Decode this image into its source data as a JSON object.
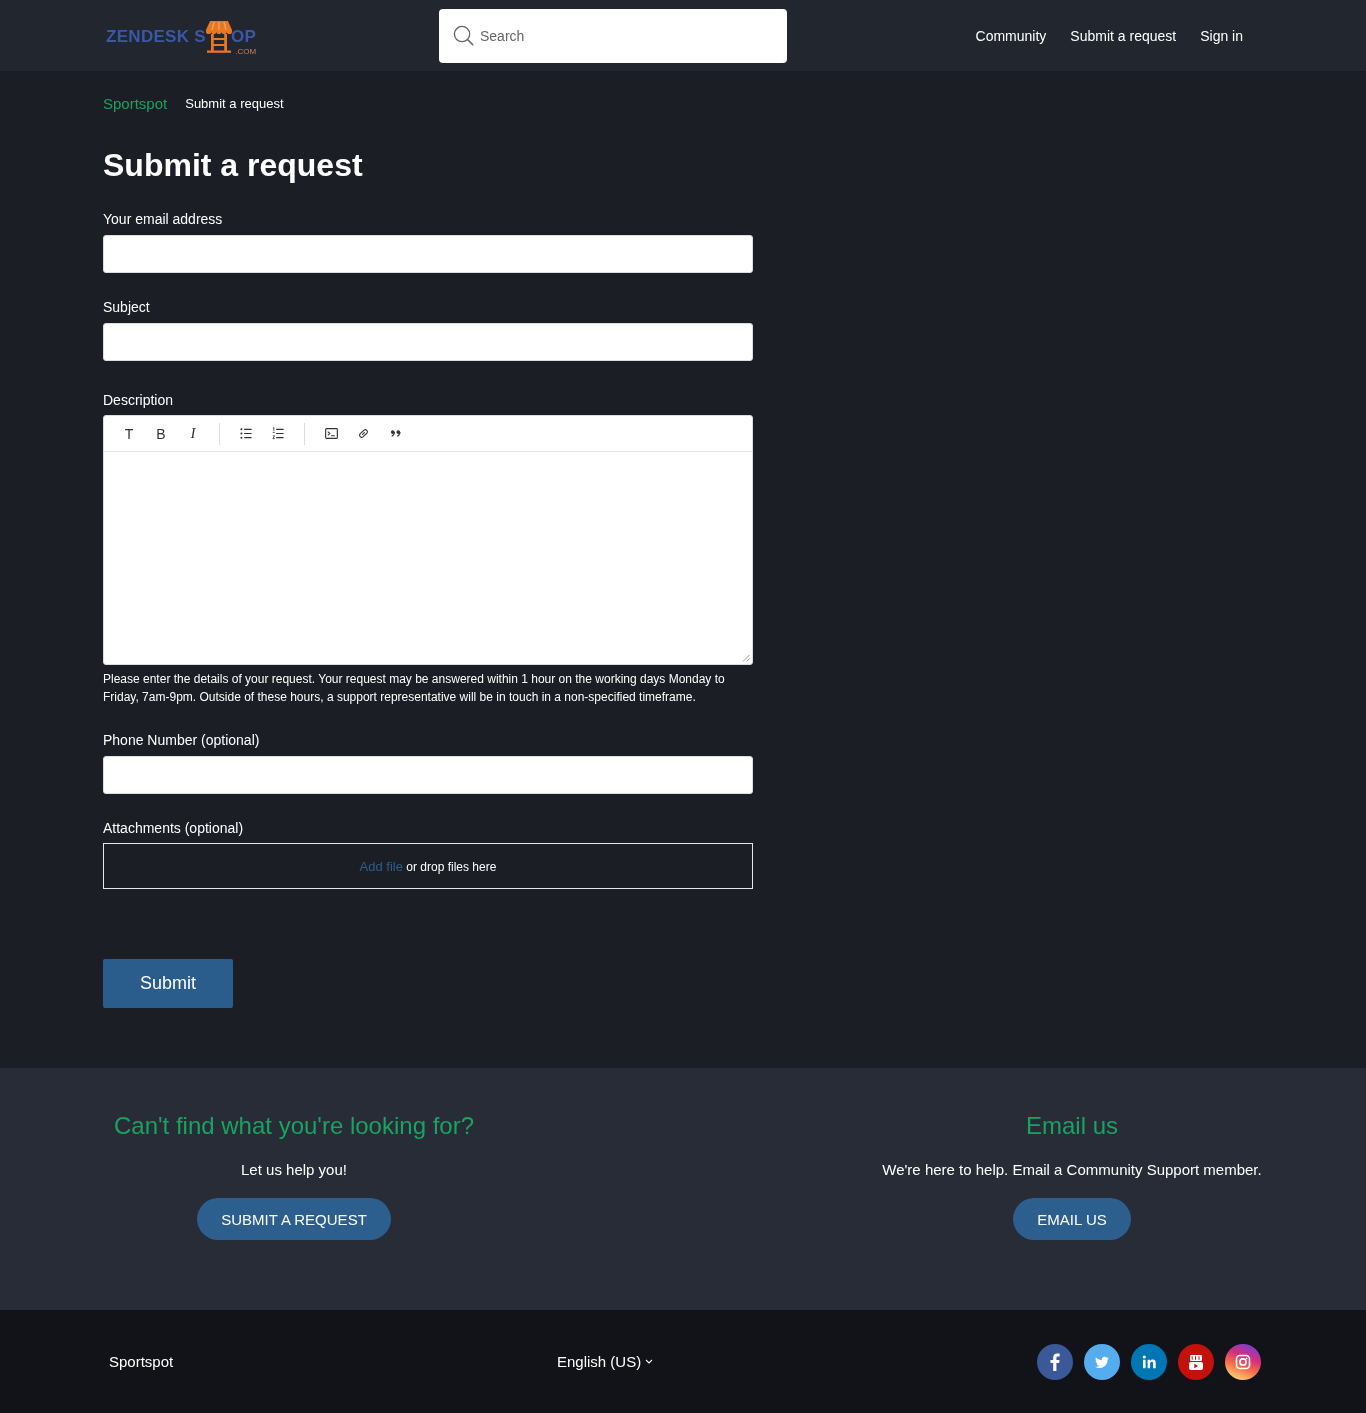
{
  "header": {
    "logo": {
      "text_before_icon": "ZENDESK S",
      "text_after_icon": "OP",
      "suffix": ".COM"
    },
    "search": {
      "placeholder": "Search"
    },
    "nav": [
      "Community",
      "Submit a request",
      "Sign in"
    ]
  },
  "breadcrumbs": [
    {
      "kind": "link",
      "label": "Sportspot"
    },
    {
      "kind": "current",
      "label": "Submit a request"
    }
  ],
  "title": "Submit a request",
  "form": {
    "fields": [
      {
        "kind": "input",
        "label": "Your email address"
      },
      {
        "kind": "input",
        "label": "Subject"
      },
      {
        "kind": "editor",
        "label": "Description",
        "toolbar": [
          {
            "buttons": [
              {
                "kind": "heading",
                "label": "T"
              },
              {
                "kind": "bold",
                "label": "B"
              },
              {
                "kind": "italic",
                "label": "I"
              }
            ]
          },
          {
            "buttons": [
              {
                "kind": "bullet-list"
              },
              {
                "kind": "numbered-list"
              }
            ]
          },
          {
            "buttons": [
              {
                "kind": "code-block"
              },
              {
                "kind": "link"
              },
              {
                "kind": "quote"
              }
            ]
          }
        ],
        "hint": "Please enter the details of your request. Your request may be answered within 1 hour on the working days Monday to Friday, 7am-9pm. Outside of these hours, a support representative will be in touch in a non-specified timeframe."
      },
      {
        "kind": "input",
        "label": "Phone Number (optional)"
      },
      {
        "kind": "dropzone",
        "label": "Attachments (optional)",
        "link": "Add file",
        "text": "or drop files here"
      }
    ],
    "submit": "Submit"
  },
  "help": [
    {
      "heading": "Can't find what you're looking for?",
      "text": "Let us help you!",
      "button": "SUBMIT A REQUEST"
    },
    {
      "heading": "Email us",
      "text": "We're here to help. Email a Community Support member.",
      "button": "EMAIL US"
    }
  ],
  "footer": {
    "brand": "Sportspot",
    "language": "English (US)",
    "social": [
      {
        "kind": "facebook"
      },
      {
        "kind": "twitter"
      },
      {
        "kind": "linkedin"
      },
      {
        "kind": "youtube"
      },
      {
        "kind": "instagram"
      }
    ]
  }
}
